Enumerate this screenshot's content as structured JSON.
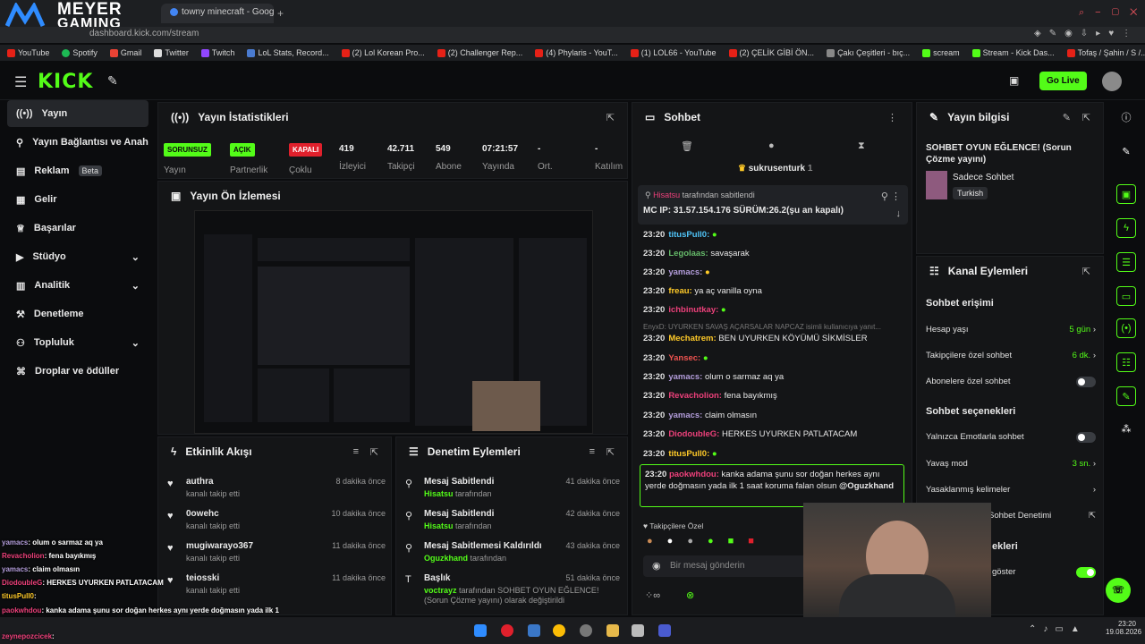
{
  "brand": {
    "line1": "MEYER",
    "line2": "GAMING"
  },
  "browser": {
    "tabs": [
      "towny minecraft - Google"
    ],
    "url": "dashboard.kick.com/stream"
  },
  "bookmarks": [
    "YouTube",
    "Spotify",
    "Gmail",
    "Twitter",
    "Twitch",
    "LoL Stats, Record...",
    "(2) Lol Korean Pro...",
    "(2) Challenger Rep...",
    "(4) Phylaris - YouT...",
    "(1) LOL66 - YouTube",
    "(2) ÇELİK GİBİ ÖN...",
    "Çakı Çeşitleri - bıç...",
    "scream",
    "Stream - Kick Das...",
    "Tofaş / Şahin / S /..."
  ],
  "header": {
    "logo": "KICK",
    "go_live": "Go Live"
  },
  "sidebar": {
    "items": [
      {
        "label": "Yayın",
        "icon": "broadcast-icon",
        "active": true
      },
      {
        "label": "Yayın Bağlantısı ve Anahtarı",
        "icon": "link-icon"
      },
      {
        "label": "Reklam",
        "icon": "ad-icon",
        "badge": "Beta"
      },
      {
        "label": "Gelir",
        "icon": "money-icon"
      },
      {
        "label": "Başarılar",
        "icon": "trophy-icon"
      },
      {
        "label": "Stüdyo",
        "icon": "video-icon",
        "chevron": true
      },
      {
        "label": "Analitik",
        "icon": "chart-icon",
        "chevron": true
      },
      {
        "label": "Denetleme",
        "icon": "hammer-icon"
      },
      {
        "label": "Topluluk",
        "icon": "community-icon",
        "chevron": true
      },
      {
        "label": "Droplar ve ödüller",
        "icon": "gift-icon"
      }
    ]
  },
  "stats": {
    "title": "Yayın İstatistikleri",
    "items": [
      {
        "value": "SORUNSUZ",
        "label": "Yayın",
        "pill": true,
        "color": "#53fc18"
      },
      {
        "value": "AÇIK",
        "label": "Partnerlik",
        "pill": true,
        "color": "#53fc18"
      },
      {
        "value": "KAPALI",
        "label": "Çoklu",
        "pill": true,
        "color": "#e0202c"
      },
      {
        "value": "419",
        "label": "İzleyici"
      },
      {
        "value": "42.711",
        "label": "Takipçi"
      },
      {
        "value": "549",
        "label": "Abone"
      },
      {
        "value": "07:21:57",
        "label": "Yayında"
      },
      {
        "value": "-",
        "label": "Ort."
      },
      {
        "value": "-",
        "label": "Katılım"
      }
    ]
  },
  "preview": {
    "title": "Yayın Ön İzlemesi"
  },
  "activity": {
    "title": "Etkinlik Akışı",
    "items": [
      {
        "name": "authra",
        "sub": "kanalı takip etti",
        "time": "8 dakika önce"
      },
      {
        "name": "0owehc",
        "sub": "kanalı takip etti",
        "time": "10 dakika önce"
      },
      {
        "name": "mugiwarayo367",
        "sub": "kanalı takip etti",
        "time": "11 dakika önce"
      },
      {
        "name": "teiosski",
        "sub": "kanalı takip etti",
        "time": "11 dakika önce"
      }
    ]
  },
  "moderation": {
    "title": "Denetim Eylemleri",
    "items": [
      {
        "action": "Mesaj Sabitlendi",
        "user": "Hisatsu",
        "suffix": "tarafından",
        "time": "41 dakika önce"
      },
      {
        "action": "Mesaj Sabitlendi",
        "user": "Hisatsu",
        "suffix": "tarafından",
        "time": "42 dakika önce"
      },
      {
        "action": "Mesaj Sabitlemesi Kaldırıldı",
        "user": "Oguzkhand",
        "suffix": "tarafından",
        "time": "43 dakika önce"
      },
      {
        "action": "Başlık",
        "user": "voctrayz",
        "suffix": "tarafından SOHBET OYUN EĞLENCE! (Sorun Çözme yayını) olarak değiştirildi",
        "time": "51 dakika önce"
      }
    ]
  },
  "chat": {
    "title": "Sohbet",
    "top_user": "sukrusenturk",
    "top_count": "1",
    "pinned": {
      "by": "Hisatsu",
      "by_suffix": "tarafından sabitlendi",
      "text": "MC IP: 31.57.154.176 SÜRÜM:26.2(şu an kapalı)"
    },
    "messages": [
      {
        "time": "23:20",
        "user": "titusPull0:",
        "color": "#4fc3f7",
        "text": ""
      },
      {
        "time": "23:20",
        "user": "Legolaas:",
        "color": "#66bb6a",
        "text": "savaşarak"
      },
      {
        "time": "23:20",
        "user": "yamacs:",
        "color": "#b39ddb",
        "text": ""
      },
      {
        "time": "23:20",
        "user": "freau:",
        "color": "#ffca28",
        "text": "ya aç vanilla oyna"
      },
      {
        "time": "23:20",
        "user": "ichbinutkay:",
        "color": "#ec407a",
        "text": ""
      },
      {
        "time": "23:20",
        "user": "Mechatrem:",
        "color": "#ffca28",
        "text": "BEN UYURKEN KÖYÜMÜ SİKMİSLER"
      },
      {
        "time": "23:20",
        "user": "Yansec:",
        "color": "#ef5350",
        "text": ""
      },
      {
        "time": "23:20",
        "user": "yamacs:",
        "color": "#b39ddb",
        "text": "olum o sarmaz aq ya"
      },
      {
        "time": "23:20",
        "user": "Revacholion:",
        "color": "#ec407a",
        "text": "fena bayıkmış"
      },
      {
        "time": "23:20",
        "user": "yamacs:",
        "color": "#b39ddb",
        "text": "claim olmasın"
      },
      {
        "time": "23:20",
        "user": "DiodoubleG:",
        "color": "#ec407a",
        "text": "HERKES UYURKEN PATLATACAM"
      },
      {
        "time": "23:20",
        "user": "titusPull0:",
        "color": "#ffca28",
        "text": ""
      }
    ],
    "reply_note": "EnyxD: UYURKEN SAVAŞ AÇARSALAR NAPCAZ isimli kullanıcıya yanıt...",
    "highlight": {
      "time": "23:20",
      "user": "paokwhdou:",
      "text": "kanka adama şunu sor doğan herkes aynı yerde doğmasın yada ilk 1 saat koruma falan olsun",
      "mention": "@Oguzkhand"
    },
    "mode_label": "Takipçilere Özel",
    "input_placeholder": "Bir mesaj gönderin"
  },
  "info": {
    "title": "Yayın bilgisi",
    "stream_title": "SOHBET OYUN EĞLENCE! (Sorun Çözme yayını)",
    "category": "Sadece Sohbet",
    "language": "Turkish"
  },
  "channel": {
    "title": "Kanal Eylemleri",
    "chat_access": "Sohbet erişimi",
    "rows": [
      {
        "label": "Hesap yaşı",
        "value": "5 gün",
        "kind": "link"
      },
      {
        "label": "Takipçilere özel sohbet",
        "value": "6 dk.",
        "kind": "link"
      },
      {
        "label": "Abonelere özel sohbet",
        "kind": "toggle",
        "on": false
      }
    ],
    "chat_options": "Sohbet seçenekleri",
    "rows2": [
      {
        "label": "Yalnızca Emotlarla sohbet",
        "kind": "toggle",
        "on": false
      },
      {
        "label": "Yavaş mod",
        "value": "3 sn.",
        "kind": "link"
      },
      {
        "label": "Yasaklanmış kelimeler",
        "kind": "link"
      },
      {
        "label": "Sohbet Denetimi",
        "kind": "external"
      }
    ],
    "partial_heading": "ekleri",
    "partial_row": "göster"
  },
  "overlay_chat": [
    {
      "user": "yamacs",
      "color": "#b39ddb",
      "text": ": olum o sarmaz aq ya"
    },
    {
      "user": "Revacholion",
      "color": "#ec407a",
      "text": ": fena bayıkmış"
    },
    {
      "user": "yamacs",
      "color": "#b39ddb",
      "text": ": claim olmasın"
    },
    {
      "user": "DiodoubleG",
      "color": "#ec407a",
      "text": ": HERKES UYURKEN PATLATACAM"
    },
    {
      "user": "titusPull0",
      "color": "#ffca28",
      "text": ": "
    },
    {
      "user": "paokwhdou",
      "color": "#ec407a",
      "text": ": kanka adama şunu sor doğan herkes aynı yerde doğmasın yada ilk 1 saat koruma falan olsun @Oguzkhand"
    },
    {
      "user": "zeynepozcicek",
      "color": "#ec407a",
      "text": ": "
    }
  ],
  "clock": {
    "time": "23:20",
    "date": "19.08.2026"
  },
  "colors": {
    "accent": "#53fc18",
    "bg": "#0b0c0e",
    "panel": "#141517"
  }
}
